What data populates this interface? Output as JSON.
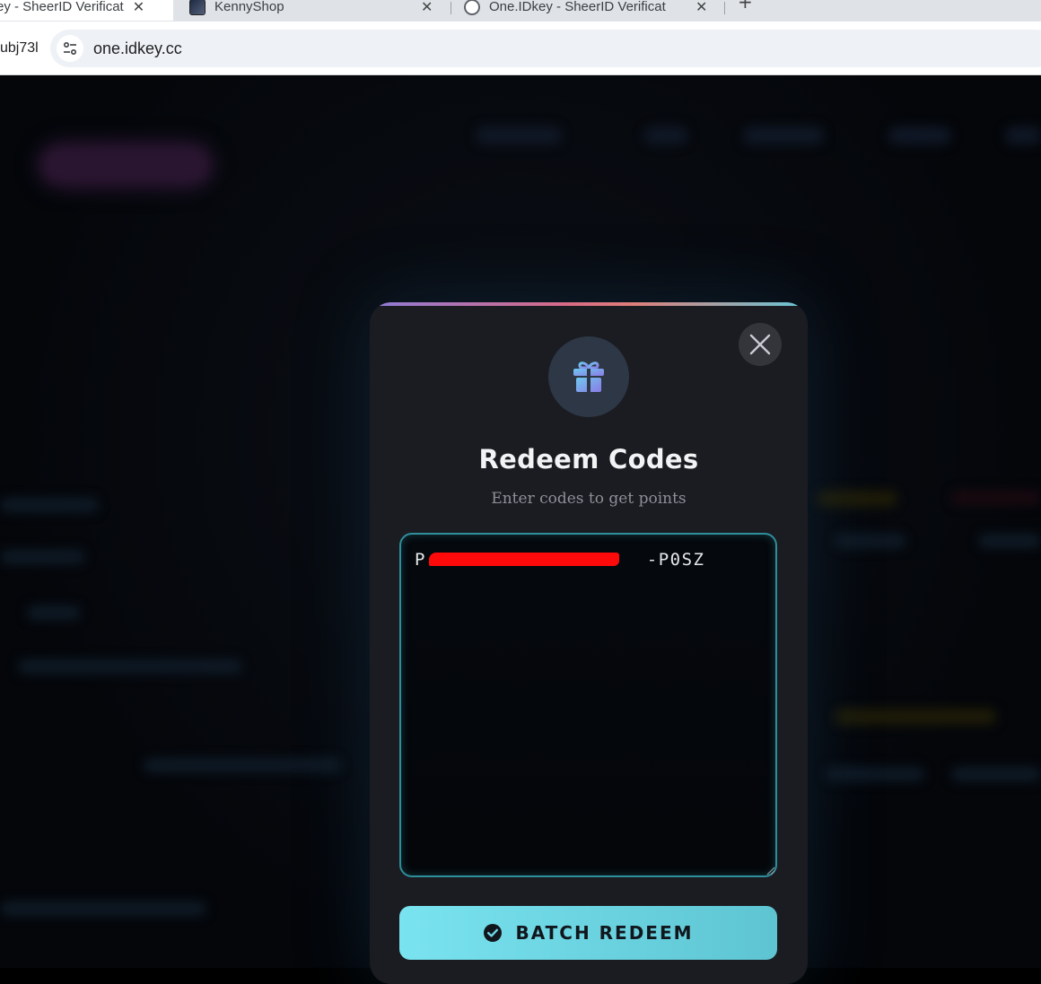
{
  "browser": {
    "tabs": [
      {
        "title": "ey - SheerID Verificat",
        "close": "✕",
        "active": true
      },
      {
        "title": "KennyShop",
        "close": "✕",
        "active": false
      },
      {
        "title": "One.IDkey - SheerID Verificat",
        "close": "✕",
        "active": false
      }
    ],
    "new_tab": "+",
    "profile_text": "ubj73l",
    "url": "one.idkey.cc"
  },
  "modal": {
    "title": "Redeem Codes",
    "subtitle": "Enter codes to get points",
    "codes_value": "P                   -P0SZ",
    "close_icon": "close-icon",
    "header_icon": "gift-icon",
    "button_icon": "check-circle-icon",
    "button_label": "BATCH REDEEM",
    "colors": {
      "accent": "#6fd6e4",
      "input_border": "#2f8e9c",
      "modal_bg": "#1b1c21",
      "redaction": "#ff0a0a"
    }
  }
}
